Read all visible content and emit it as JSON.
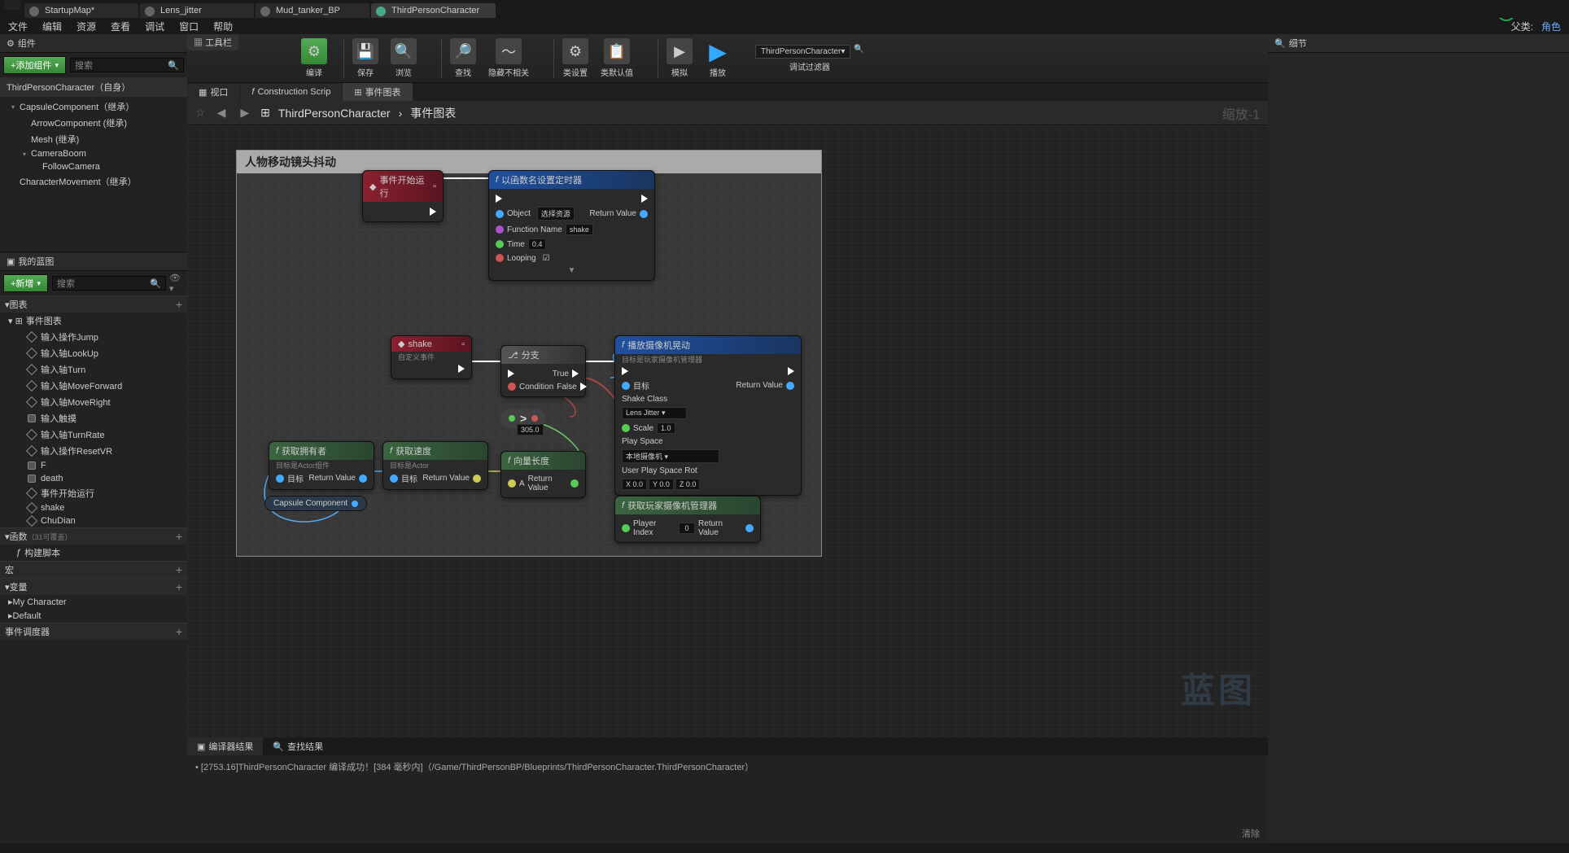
{
  "tabs": [
    "StartupMap*",
    "Lens_jitter",
    "Mud_tanker_BP",
    "ThirdPersonCharacter"
  ],
  "menu": [
    "文件",
    "编辑",
    "资源",
    "查看",
    "调试",
    "窗口",
    "帮助"
  ],
  "menuRight": {
    "parent": "父类:",
    "role": "角色"
  },
  "panels": {
    "components": "组件",
    "myBlueprint": "我的蓝图",
    "details": "细节",
    "toolbarLabel": "工具栏"
  },
  "addComponent": "+添加组件",
  "searchPlaceholder": "搜索",
  "selfLabel": "ThirdPersonCharacter（自身）",
  "componentTree": [
    {
      "label": "CapsuleComponent（继承）",
      "indent": 1,
      "arrow": "▾"
    },
    {
      "label": "ArrowComponent (继承)",
      "indent": 2
    },
    {
      "label": "Mesh (继承)",
      "indent": 2
    },
    {
      "label": "CameraBoom",
      "indent": 2,
      "arrow": "▾"
    },
    {
      "label": "FollowCamera",
      "indent": 3
    },
    {
      "label": "CharacterMovement（继承）",
      "indent": 1
    }
  ],
  "newBtn": "+新增",
  "sections": {
    "graphs": "图表",
    "eventGraph": "事件图表",
    "functions": {
      "label": "函数",
      "count": "（31可覆盖）"
    },
    "macros": "宏",
    "variables": "变量",
    "dispatchers": "事件调度器"
  },
  "graphItems": [
    "输入操作Jump",
    "输入轴LookUp",
    "输入轴Turn",
    "输入轴MoveForward",
    "输入轴MoveRight",
    "输入触摸",
    "输入轴TurnRate",
    "输入操作ResetVR",
    "F",
    "death",
    "事件开始运行",
    "shake",
    "ChuDian"
  ],
  "funcItems": [
    "构建脚本"
  ],
  "varGroups": [
    "My Character",
    "Default"
  ],
  "toolbar": {
    "compile": "编译",
    "save": "保存",
    "browse": "浏览",
    "find": "查找",
    "hide": "隐藏不相关",
    "classSettings": "类设置",
    "classDefaults": "类默认值",
    "simulate": "模拟",
    "play": "播放",
    "debugSel": "ThirdPersonCharacter",
    "debugLabel": "调试过滤器"
  },
  "subtabs": {
    "viewport": "视口",
    "construction": "Construction Scrip",
    "eventGraph": "事件图表"
  },
  "breadcrumb": {
    "asset": "ThirdPersonCharacter",
    "graph": "事件图表",
    "zoom": "缩放-1"
  },
  "comment": {
    "title": "人物移动镜头抖动"
  },
  "nodes": {
    "beginPlay": {
      "title": "事件开始运行"
    },
    "timer": {
      "title": "以函数名设置定时器",
      "object": "Object",
      "objectSel": "选择资源",
      "funcName": "Function Name",
      "funcVal": "shake",
      "time": "Time",
      "timeVal": "0.4",
      "looping": "Looping",
      "returnVal": "Return Value"
    },
    "shake": {
      "title": "shake",
      "sub": "自定义事件"
    },
    "branch": {
      "title": "分支",
      "condition": "Condition",
      "true": "True",
      "false": "False"
    },
    "getOwner": {
      "title": "获取拥有者",
      "sub": "目标是Actor组件",
      "target": "目标",
      "ret": "Return Value"
    },
    "getVelocity": {
      "title": "获取速度",
      "sub": "目标是Actor",
      "target": "目标",
      "ret": "Return Value"
    },
    "vecLen": {
      "title": "向量长度",
      "a": "A",
      "ret": "Return Value"
    },
    "greater": {
      "val": "305.0"
    },
    "capsule": "Capsule Component",
    "playShake": {
      "title": "播放摄像机晃动",
      "sub": "目标是玩家摄像机管理器",
      "target": "目标",
      "shakeClass": "Shake Class",
      "shakeSel": "Lens Jitter",
      "scale": "Scale",
      "scaleVal": "1.0",
      "playSpace": "Play Space",
      "playSpaceSel": "本地摄像机",
      "userRot": "User Play Space Rot",
      "x": "0.0",
      "y": "0.0",
      "z": "0.0",
      "ret": "Return Value"
    },
    "getPCM": {
      "title": "获取玩家摄像机管理器",
      "playerIndex": "Player Index",
      "piVal": "0",
      "ret": "Return Value"
    }
  },
  "watermark": "蓝图",
  "bottomTabs": {
    "compiler": "编译器结果",
    "find": "查找结果"
  },
  "compileMsg": "[2753.16]ThirdPersonCharacter 编译成功！[384 毫秒内]（/Game/ThirdPersonBP/Blueprints/ThirdPersonCharacter.ThirdPersonCharacter）",
  "clearLabel": "清除"
}
